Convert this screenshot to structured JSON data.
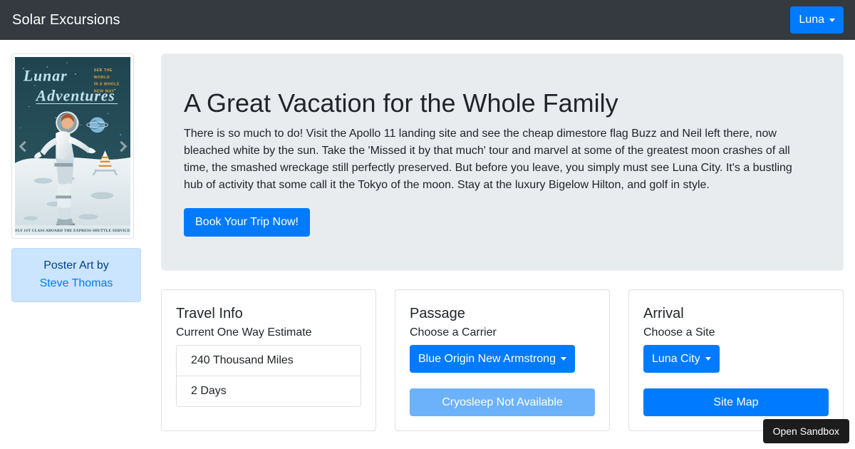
{
  "navbar": {
    "brand": "Solar Excursions",
    "user_button": "Luna"
  },
  "sidebar": {
    "carousel": {
      "prev_label": "Previous",
      "next_label": "Next",
      "poster": {
        "title_line1": "Lunar",
        "title_line2": "Adventures",
        "tagline_line1": "SEE THE",
        "tagline_line2": "WORLD",
        "tagline_line3": "IN A WHOLE",
        "tagline_line4": "NEW WAY",
        "footer": "FLY 1ST CLASS ABOARD THE EXPRESS SHUTTLE SERVICE"
      }
    },
    "alert": {
      "text": "Poster Art by",
      "link": "Steve Thomas"
    }
  },
  "jumbotron": {
    "title": "A Great Vacation for the Whole Family",
    "body": "There is so much to do! Visit the Apollo 11 landing site and see the cheap dimestore flag Buzz and Neil left there, now bleached white by the sun. Take the 'Missed it by that much' tour and marvel at some of the greatest moon crashes of all time, the smashed wreckage still perfectly preserved. But before you leave, you simply must see Luna City. It's a bustling hub of activity that some call it the Tokyo of the moon. Stay at the luxury Bigelow Hilton, and golf in style.",
    "cta": "Book Your Trip Now!"
  },
  "cards": [
    {
      "title": "Travel Info",
      "subtitle": "Current One Way Estimate",
      "list": [
        "240 Thousand Miles",
        "2 Days"
      ]
    },
    {
      "title": "Passage",
      "subtitle": "Choose a Carrier",
      "dropdown": "Blue Origin New Armstrong",
      "action": "Cryosleep Not Available"
    },
    {
      "title": "Arrival",
      "subtitle": "Choose a Site",
      "dropdown": "Luna City",
      "action": "Site Map"
    }
  ],
  "overlay": {
    "sandbox_label": "Open Sandbox"
  },
  "colors": {
    "navbar_bg": "#343a40",
    "primary": "#007bff",
    "primary_muted": "#6cb2fb",
    "jumbotron_bg": "#e9ecef",
    "alert_bg": "#cce5ff",
    "alert_text": "#004085",
    "sandbox_bg": "#1c1c1c"
  }
}
